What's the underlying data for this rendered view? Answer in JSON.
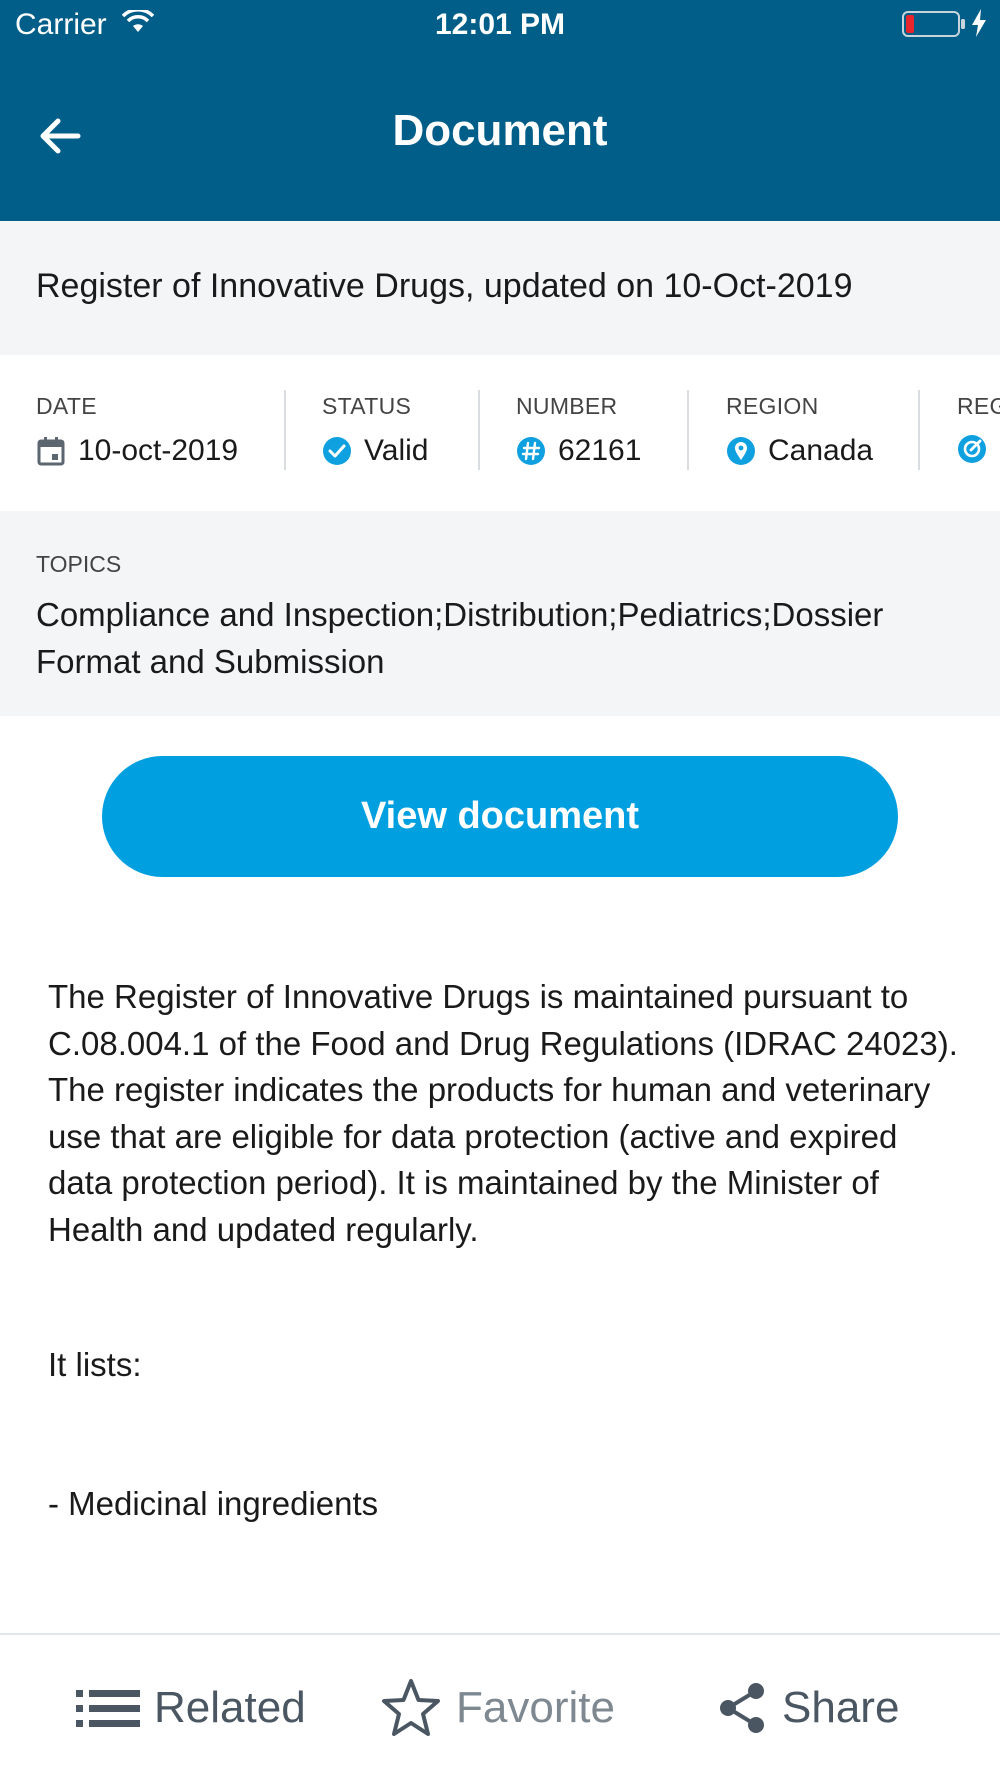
{
  "status_bar": {
    "carrier": "Carrier",
    "time": "12:01 PM"
  },
  "nav": {
    "title": "Document"
  },
  "document": {
    "header": "Register of Innovative Drugs, updated on 10-Oct-2019"
  },
  "meta": {
    "date": {
      "label": "DATE",
      "value": "10-oct-2019",
      "icon": "calendar-icon"
    },
    "status": {
      "label": "STATUS",
      "value": "Valid",
      "icon": "check-circle-icon"
    },
    "number": {
      "label": "NUMBER",
      "value": "62161",
      "icon": "hash-icon"
    },
    "region": {
      "label": "REGION",
      "value": "Canada",
      "icon": "location-pin-icon"
    },
    "partial": {
      "label": "REG",
      "icon": "edit-circle-icon"
    }
  },
  "topics": {
    "label": "TOPICS",
    "value": "Compliance and Inspection;Distribution;Pediatrics;Dossier Format and Submission"
  },
  "actions": {
    "view_document": "View document"
  },
  "body": {
    "description": "The Register of Innovative Drugs is maintained pursuant to C.08.004.1 of the Food and Drug Regulations (IDRAC 24023). The register indicates the products for human and veterinary use that are eligible for data protection (active and expired data protection period). It is maintained by the Minister of Health and updated regularly.",
    "lists_label": "It lists:",
    "list_item": "- Medicinal ingredients"
  },
  "tabs": {
    "related": "Related",
    "favorite": "Favorite",
    "share": "Share"
  },
  "colors": {
    "header_bg": "#005e88",
    "accent": "#009fe0",
    "panel_bg": "#f4f5f7"
  }
}
